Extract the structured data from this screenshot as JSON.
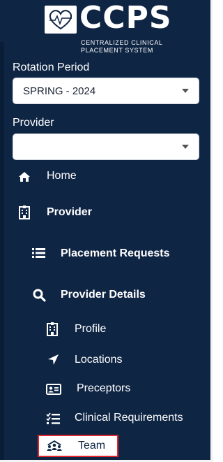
{
  "brand": {
    "title": "CCPS",
    "subtitle_line1": "CENTRALIZED CLINICAL",
    "subtitle_line2": "PLACEMENT SYSTEM"
  },
  "filters": {
    "rotation_label": "Rotation Period",
    "rotation_value": "SPRING - 2024",
    "provider_label": "Provider",
    "provider_value": ""
  },
  "nav": {
    "home": "Home",
    "provider": "Provider",
    "placement_requests": "Placement Requests",
    "provider_details": "Provider Details",
    "profile": "Profile",
    "locations": "Locations",
    "preceptors": "Preceptors",
    "clinical_requirements": "Clinical Requirements",
    "team": "Team"
  },
  "colors": {
    "sidebar_bg": "#0f2544",
    "highlight_border": "#e0262e"
  },
  "icons": {
    "home": "home-icon",
    "provider": "hospital-icon",
    "placement_requests": "list-icon",
    "provider_details": "search-icon",
    "profile": "building-icon",
    "locations": "location-arrow-icon",
    "preceptors": "id-card-icon",
    "clinical_requirements": "checklist-icon",
    "team": "team-icon"
  }
}
